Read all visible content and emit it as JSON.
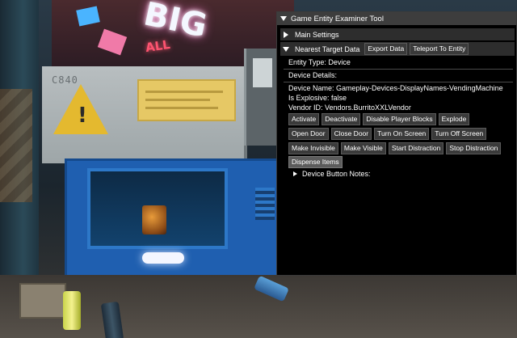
{
  "tool_window": {
    "title": "Game Entity Examiner Tool",
    "main_settings_label": "Main Settings",
    "nearest_target_label": "Nearest Target Data",
    "export_data_label": "Export Data",
    "teleport_label": "Teleport To Entity",
    "entity_type": "Entity Type: Device",
    "device_details": "Device Details:",
    "device_name": "Device Name: Gameplay-Devices-DisplayNames-VendingMachine",
    "is_explosive": "Is Explosive: false",
    "vendor_id": "Vendor ID: Vendors.BurritoXXLVendor",
    "button_rows": [
      [
        "Activate",
        "Deactivate",
        "Disable Player Blocks",
        "Explode"
      ],
      [
        "Open Door",
        "Close Door",
        "Turn On Screen",
        "Turn Off Screen"
      ],
      [
        "Make Invisible",
        "Make Visible",
        "Start Distraction",
        "Stop Distraction"
      ],
      [
        "Dispense Items"
      ]
    ],
    "device_button_notes": "Device Button Notes:"
  },
  "scene": {
    "neon_big": "BIG",
    "neon_all": "ALL",
    "machine_code": "C840",
    "warning_mark": "!"
  }
}
